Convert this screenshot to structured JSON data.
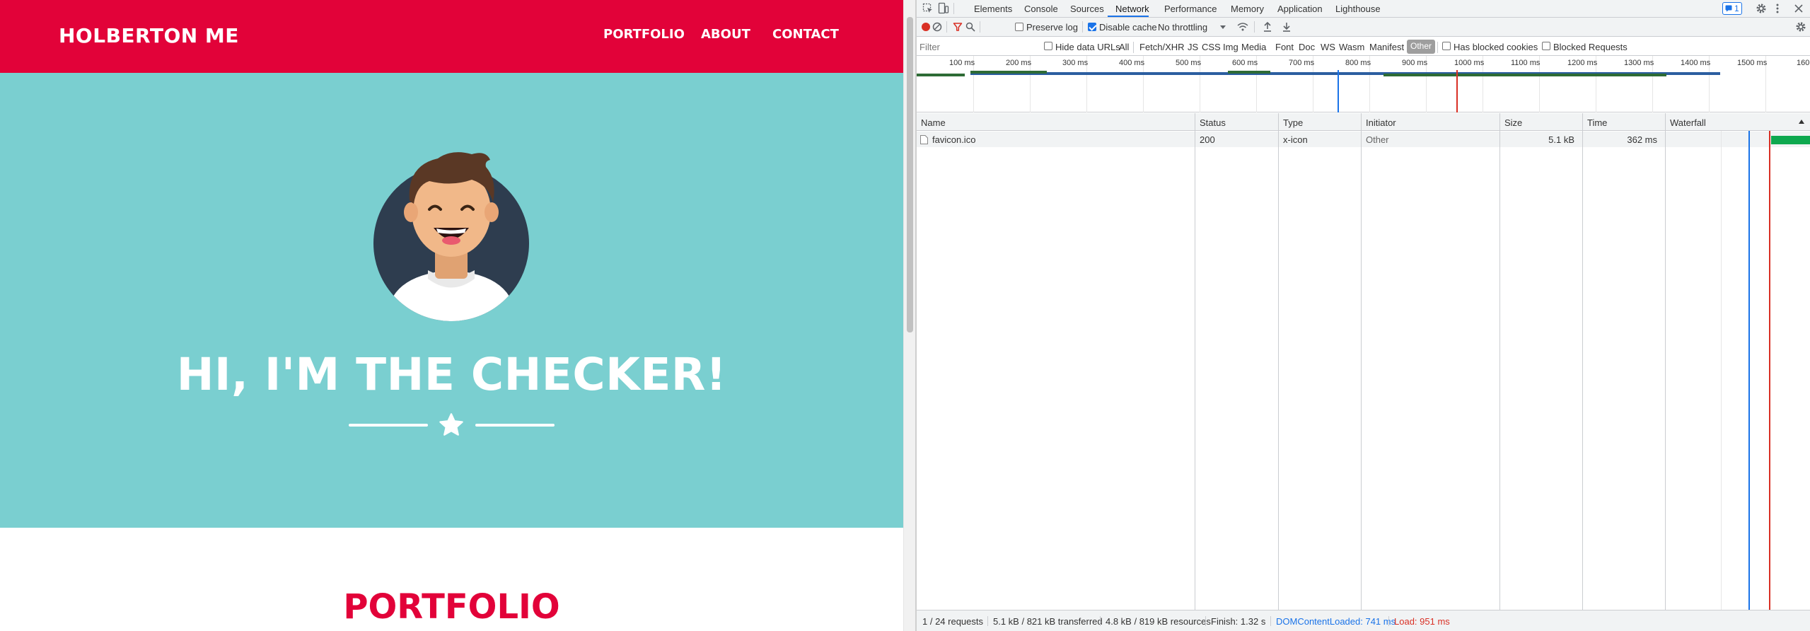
{
  "page": {
    "brand": "HOLBERTON ME",
    "nav": [
      "PORTFOLIO",
      "ABOUT",
      "CONTACT"
    ],
    "hero_title": "HI, I'M THE CHECKER!",
    "section_heading": "PORTFOLIO",
    "colors": {
      "nav_bg": "#e20239",
      "hero_bg": "#7acfd0",
      "heading": "#e20239"
    }
  },
  "devtools": {
    "tabs": [
      "Elements",
      "Console",
      "Sources",
      "Network",
      "Performance",
      "Memory",
      "Application",
      "Lighthouse"
    ],
    "active_tab": "Network",
    "issues_count": "1",
    "toolbar": {
      "preserve_log": "Preserve log",
      "preserve_log_checked": false,
      "disable_cache": "Disable cache",
      "disable_cache_checked": true,
      "throttling": "No throttling"
    },
    "filter": {
      "placeholder": "Filter",
      "hide_data_urls": "Hide data URLs",
      "types": [
        "All",
        "Fetch/XHR",
        "JS",
        "CSS",
        "Img",
        "Media",
        "Font",
        "Doc",
        "WS",
        "Wasm",
        "Manifest",
        "Other"
      ],
      "active_type": "Other",
      "has_blocked_cookies": "Has blocked cookies",
      "blocked_requests": "Blocked Requests"
    },
    "overview_ticks": [
      "100 ms",
      "200 ms",
      "300 ms",
      "400 ms",
      "500 ms",
      "600 ms",
      "700 ms",
      "800 ms",
      "900 ms",
      "1000 ms",
      "1100 ms",
      "1200 ms",
      "1300 ms",
      "1400 ms",
      "1500 ms",
      "160"
    ],
    "columns": [
      "Name",
      "Status",
      "Type",
      "Initiator",
      "Size",
      "Time",
      "Waterfall"
    ],
    "rows": [
      {
        "name": "favicon.ico",
        "status": "200",
        "type": "x-icon",
        "initiator": "Other",
        "size": "5.1 kB",
        "time": "362 ms"
      }
    ],
    "status": {
      "requests": "1 / 24 requests",
      "transferred": "5.1 kB / 821 kB transferred",
      "resources": "4.8 kB / 819 kB resources",
      "finish": "Finish: 1.32 s",
      "dom_content_loaded": "DOMContentLoaded: 741 ms",
      "load": "Load: 951 ms"
    },
    "colors": {
      "accent": "#1a73e8",
      "record": "#d93025",
      "dcl": "#1a73e8",
      "load": "#d93025",
      "waterfall_bar": "#0ea84f"
    }
  }
}
